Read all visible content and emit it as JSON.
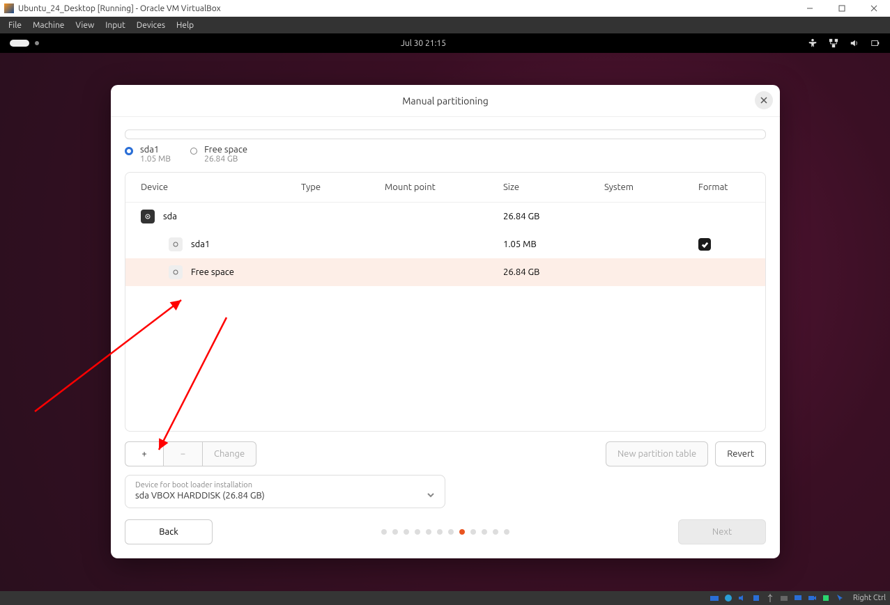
{
  "vb": {
    "title": "Ubuntu_24_Desktop [Running] - Oracle VM VirtualBox",
    "menu": [
      "File",
      "Machine",
      "View",
      "Input",
      "Devices",
      "Help"
    ],
    "rightctrl": "Right Ctrl"
  },
  "guest": {
    "datetime": "Jul 30  21:15"
  },
  "dialog": {
    "title": "Manual partitioning",
    "legend": [
      {
        "name": "sda1",
        "size": "1.05 MB",
        "active": true
      },
      {
        "name": "Free space",
        "size": "26.84 GB",
        "active": false
      }
    ],
    "columns": [
      "Device",
      "Type",
      "Mount point",
      "Size",
      "System",
      "Format"
    ],
    "rows": [
      {
        "device": "sda",
        "indent": 0,
        "iconDark": true,
        "size": "26.84 GB",
        "format": false
      },
      {
        "device": "sda1",
        "indent": 1,
        "iconDark": false,
        "size": "1.05 MB",
        "format": true
      },
      {
        "device": "Free space",
        "indent": 1,
        "iconDark": false,
        "size": "26.84 GB",
        "format": false,
        "selected": true
      }
    ],
    "toolbar": {
      "add": "+",
      "remove": "−",
      "change": "Change",
      "new_table": "New partition table",
      "revert": "Revert"
    },
    "boot": {
      "label": "Device for boot loader installation",
      "value": "sda VBOX HARDDISK (26.84 GB)"
    },
    "back": "Back",
    "next": "Next",
    "step_active_index": 7,
    "step_count": 12
  }
}
